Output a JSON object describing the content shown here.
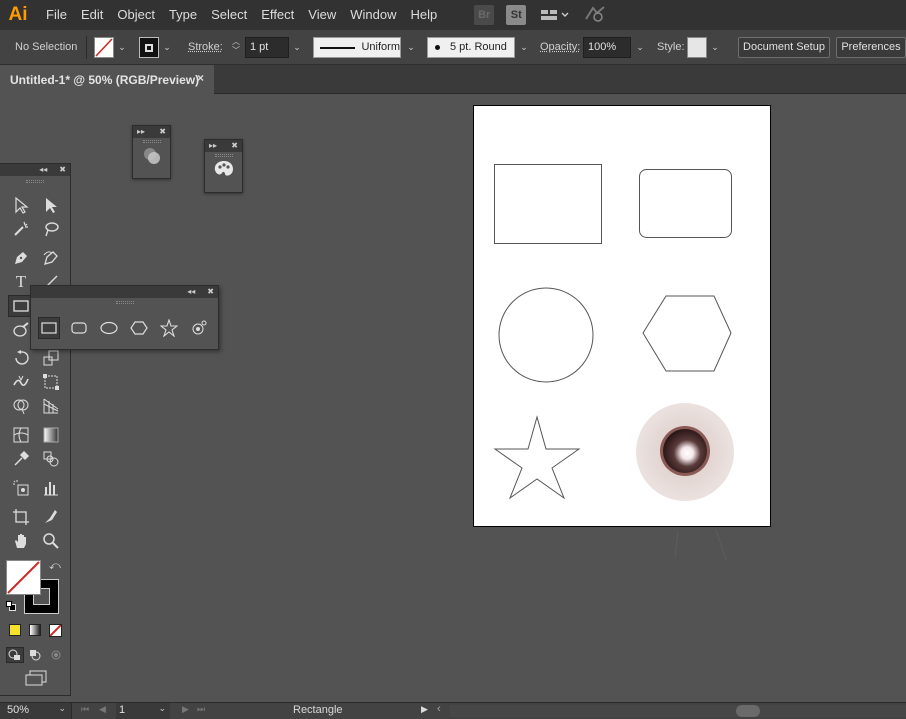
{
  "app": {
    "logo": "Ai"
  },
  "menu": [
    "File",
    "Edit",
    "Object",
    "Type",
    "Select",
    "Effect",
    "View",
    "Window",
    "Help"
  ],
  "top_icons": {
    "bridge": "Br",
    "stock": "St"
  },
  "control_bar": {
    "selection": "No Selection",
    "stroke_label": "Stroke:",
    "stroke_weight": "1 pt",
    "profile": "Uniform",
    "brush": "5 pt. Round",
    "opacity_label": "Opacity:",
    "opacity": "100%",
    "style_label": "Style:",
    "document_setup": "Document Setup",
    "preferences": "Preferences"
  },
  "document_tab": {
    "title": "Untitled-1* @ 50% (RGB/Preview)",
    "close": "×"
  },
  "status_bar": {
    "zoom": "50%",
    "artboard": "1",
    "tool": "Rectangle"
  },
  "colors": {
    "accent": "#ff9a00",
    "app_bg": "#535353",
    "menubar": "#323232",
    "fill_none_slash": "#cc2b2b",
    "logo": "#ff9a00"
  },
  "tools": [
    "selection-tool",
    "direct-selection-tool",
    "magic-wand-tool",
    "lasso-tool",
    "pen-tool",
    "curvature-tool",
    "type-tool",
    "line-segment-tool",
    "rectangle-tool",
    "shaper-tool",
    "rotate-tool",
    "scale-tool",
    "width-tool",
    "free-transform-tool",
    "shape-builder-tool",
    "perspective-grid-tool",
    "mesh-tool",
    "gradient-tool",
    "eyedropper-tool",
    "blend-tool",
    "symbol-sprayer-tool",
    "column-graph-tool",
    "artboard-tool",
    "slice-tool",
    "hand-tool",
    "zoom-tool"
  ],
  "flyout_tools": [
    "rectangle-tool",
    "rounded-rectangle-tool",
    "ellipse-tool",
    "polygon-tool",
    "star-tool",
    "flare-tool"
  ]
}
